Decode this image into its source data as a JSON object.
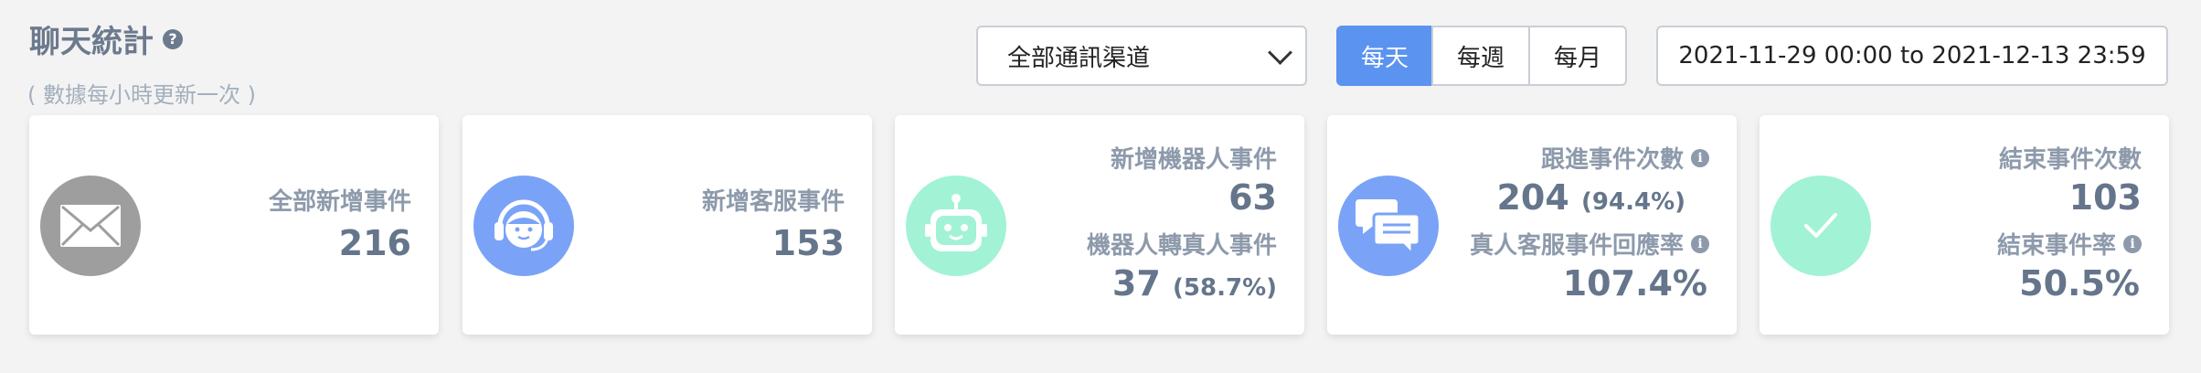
{
  "header": {
    "title": "聊天統計",
    "subtitle": "( 數據每小時更新一次 )",
    "help_icon": "question-circle-icon"
  },
  "filters": {
    "channel": {
      "selected": "全部通訊渠道"
    },
    "period": {
      "options": [
        "每天",
        "每週",
        "每月"
      ],
      "active": "每天"
    },
    "date_range": "2021-11-29 00:00 to 2021-12-13 23:59"
  },
  "cards": [
    {
      "icon": "envelope-icon",
      "icon_color": "#9e9e9e",
      "label": "全部新增事件",
      "value": "216"
    },
    {
      "icon": "headset-agent-icon",
      "icon_color": "#7aa3f7",
      "label": "新增客服事件",
      "value": "153"
    },
    {
      "icon": "robot-icon",
      "icon_color": "#a2f2d6",
      "label": "新增機器人事件",
      "value": "63",
      "label2": "機器人轉真人事件",
      "value2": "37",
      "value2_pct": "(58.7%)"
    },
    {
      "icon": "chat-bubbles-icon",
      "icon_color": "#7aa3f7",
      "label": "跟進事件次數",
      "value": "204",
      "value_pct": "(94.4%)",
      "label2": "真人客服事件回應率",
      "value2": "107.4%"
    },
    {
      "icon": "check-icon",
      "icon_color": "#a2f2d6",
      "label": "結束事件次數",
      "value": "103",
      "label2": "結束事件率",
      "value2": "50.5%"
    }
  ],
  "colors": {
    "accent": "#5b93f0",
    "text": "#6c7a8d",
    "muted": "#a3afbd"
  }
}
